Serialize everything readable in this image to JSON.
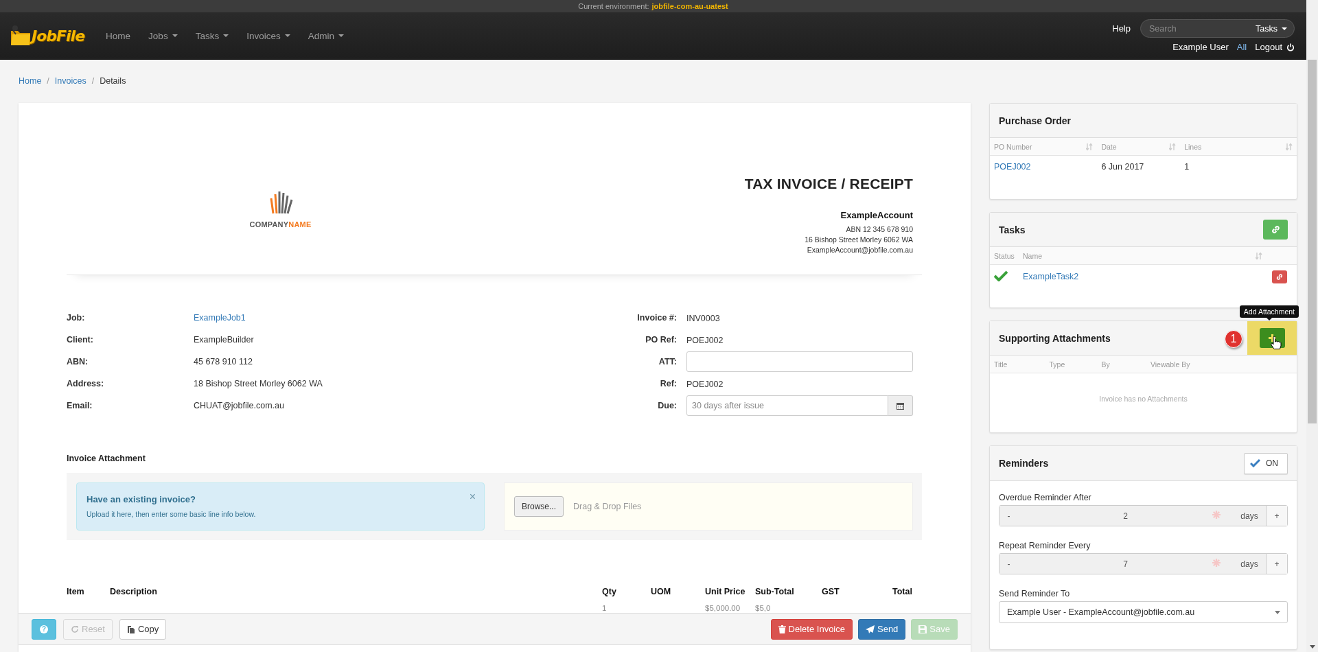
{
  "environment": {
    "label": "Current environment:",
    "value": "jobfile-com-au-uatest"
  },
  "navbar": {
    "brand": "JobFile",
    "menu": [
      {
        "label": "Home",
        "dropdown": false
      },
      {
        "label": "Jobs",
        "dropdown": true
      },
      {
        "label": "Tasks",
        "dropdown": true
      },
      {
        "label": "Invoices",
        "dropdown": true
      },
      {
        "label": "Admin",
        "dropdown": true
      }
    ],
    "help": "Help",
    "search": {
      "placeholder": "Search",
      "scope": "Tasks"
    },
    "user": "Example User",
    "all": "All",
    "logout": "Logout"
  },
  "breadcrumb": [
    {
      "label": "Home",
      "link": true
    },
    {
      "separator": "/",
      "label": "Invoices",
      "link": true
    },
    {
      "separator": "/",
      "label": "Details",
      "link": false
    }
  ],
  "invoice": {
    "logo": {
      "dark": "COMPANY",
      "accent": "NAME"
    },
    "title": "TAX INVOICE / RECEIPT",
    "account": {
      "name": "ExampleAccount",
      "lines": [
        "ABN 12 345 678 910",
        "16 Bishop Street Morley 6062 WA",
        "ExampleAccount@jobfile.com.au"
      ]
    },
    "details_left": [
      {
        "label": "Job:",
        "value": "ExampleJob1",
        "kind": "link"
      },
      {
        "label": "Client:",
        "value": "ExampleBuilder",
        "kind": "text"
      },
      {
        "label": "ABN:",
        "value": "45 678 910 112",
        "kind": "text"
      },
      {
        "label": "Address:",
        "value": "18 Bishop Street Morley 6062 WA",
        "kind": "text"
      },
      {
        "label": "Email:",
        "value": "CHUAT@jobfile.com.au",
        "kind": "text"
      }
    ],
    "details_right": [
      {
        "label": "Invoice #:",
        "value": "INV0003",
        "kind": "text"
      },
      {
        "label": "PO Ref:",
        "value": "POEJ002",
        "kind": "text"
      },
      {
        "label": "ATT:",
        "kind": "input"
      },
      {
        "label": "Ref:",
        "value": "POEJ002",
        "kind": "text"
      },
      {
        "label": "Due:",
        "placeholder": "30 days after issue",
        "kind": "date"
      }
    ],
    "attachment": {
      "heading": "Invoice Attachment",
      "alert": {
        "title": "Have an existing invoice?",
        "text": "Upload it here, then enter some basic line info below.",
        "close": "×"
      },
      "browse": "Browse...",
      "drop_hint": "Drag & Drop Files"
    },
    "line_items": {
      "columns": [
        "Item",
        "Description",
        "Qty",
        "UOM",
        "Unit Price",
        "Sub-Total",
        "GST",
        "Total"
      ],
      "rows": [
        {
          "qty": "1",
          "unit_price": "$5,000.00",
          "sub_total": "$5,0"
        }
      ]
    }
  },
  "action_bar": {
    "left": [
      {
        "kind": "help",
        "label": "?",
        "disabled": false
      },
      {
        "kind": "reset",
        "label": "Reset",
        "disabled": true
      },
      {
        "kind": "copy",
        "label": "Copy",
        "disabled": false
      }
    ],
    "right": [
      {
        "kind": "delete",
        "label": "Delete Invoice",
        "disabled": false
      },
      {
        "kind": "send",
        "label": "Send",
        "disabled": false
      },
      {
        "kind": "save",
        "label": "Save",
        "disabled": true
      }
    ]
  },
  "purchase_order": {
    "title": "Purchase Order",
    "columns": [
      "PO Number",
      "Date",
      "Lines"
    ],
    "rows": [
      {
        "po_number": "POEJ002",
        "date": "6 Jun 2017",
        "lines": "1"
      }
    ]
  },
  "tasks": {
    "title": "Tasks",
    "columns": [
      "Status",
      "Name"
    ],
    "rows": [
      {
        "done": true,
        "name": "ExampleTask2"
      }
    ]
  },
  "attachments": {
    "title": "Supporting Attachments",
    "tooltip": "Add Attachment",
    "step_badge": "1",
    "columns": [
      "Title",
      "Type",
      "By",
      "Viewable By"
    ],
    "empty_message": "Invoice has no Attachments"
  },
  "reminders": {
    "title": "Reminders",
    "on": true,
    "on_label": "ON",
    "fields": [
      {
        "label": "Overdue Reminder After",
        "decrement": "-",
        "value": "2",
        "required": true,
        "unit": "days",
        "increment": "+"
      },
      {
        "label": "Repeat Reminder Every",
        "decrement": "-",
        "value": "7",
        "required": true,
        "unit": "days",
        "increment": "+"
      }
    ],
    "send_to": {
      "label": "Send Reminder To",
      "value": "Example User - ExampleAccount@jobfile.com.au"
    }
  }
}
